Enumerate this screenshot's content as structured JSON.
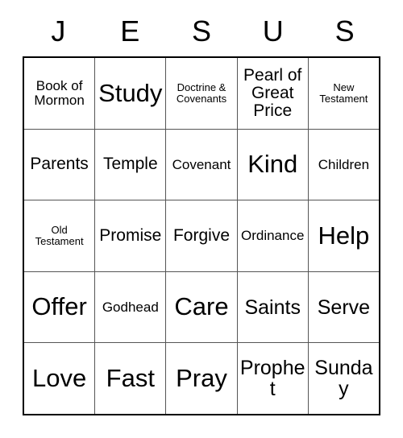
{
  "card": {
    "header_letters": [
      "J",
      "E",
      "S",
      "U",
      "S"
    ],
    "rows": [
      [
        {
          "label": "Book of Mormon",
          "size": "s"
        },
        {
          "label": "Study",
          "size": "xl"
        },
        {
          "label": "Doctrine & Covenants",
          "size": "xs"
        },
        {
          "label": "Pearl of Great Price",
          "size": "m"
        },
        {
          "label": "New Testament",
          "size": "xs"
        }
      ],
      [
        {
          "label": "Parents",
          "size": "m"
        },
        {
          "label": "Temple",
          "size": "m"
        },
        {
          "label": "Covenant",
          "size": "s"
        },
        {
          "label": "Kind",
          "size": "xl"
        },
        {
          "label": "Children",
          "size": "s"
        }
      ],
      [
        {
          "label": "Old Testament",
          "size": "xs"
        },
        {
          "label": "Promise",
          "size": "m"
        },
        {
          "label": "Forgive",
          "size": "m"
        },
        {
          "label": "Ordinance",
          "size": "s"
        },
        {
          "label": "Help",
          "size": "xl"
        }
      ],
      [
        {
          "label": "Offer",
          "size": "xl"
        },
        {
          "label": "Godhead",
          "size": "s"
        },
        {
          "label": "Care",
          "size": "xl"
        },
        {
          "label": "Saints",
          "size": "l"
        },
        {
          "label": "Serve",
          "size": "l"
        }
      ],
      [
        {
          "label": "Love",
          "size": "xl"
        },
        {
          "label": "Fast",
          "size": "xl"
        },
        {
          "label": "Pray",
          "size": "xl"
        },
        {
          "label": "Prophet",
          "size": "l"
        },
        {
          "label": "Sunday",
          "size": "l"
        }
      ]
    ],
    "colors": {
      "background": "#ffffff",
      "text": "#000000",
      "outer_border": "#000000",
      "inner_border": "#555555"
    }
  }
}
